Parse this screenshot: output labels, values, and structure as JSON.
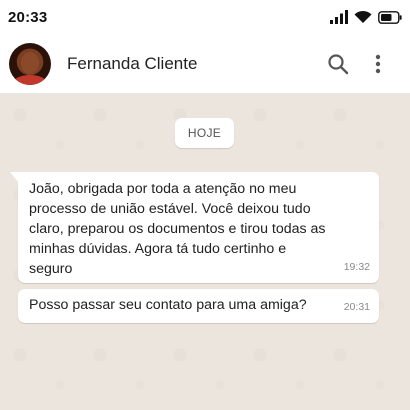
{
  "status_bar": {
    "time": "20:33",
    "icons": [
      "signal-icon",
      "wifi-icon",
      "battery-icon"
    ]
  },
  "header": {
    "contact_name": "Fernanda Cliente",
    "avatar_icon": "avatar",
    "actions": [
      "search-icon",
      "more-vertical-icon"
    ]
  },
  "chat": {
    "day_label": "HOJE",
    "messages": [
      {
        "text": "João, obrigada por toda a atenção no meu processo de união estável. Você deixou tudo claro, preparou os documentos e tirou todas as minhas dúvidas. Agora tá tudo certinho e seguro",
        "time": "19:32"
      },
      {
        "text": "Posso passar seu contato para uma amiga?",
        "time": "20:31"
      }
    ]
  },
  "colors": {
    "chat_background": "#ece5dd",
    "bubble": "#ffffff",
    "header": "#ffffff"
  }
}
